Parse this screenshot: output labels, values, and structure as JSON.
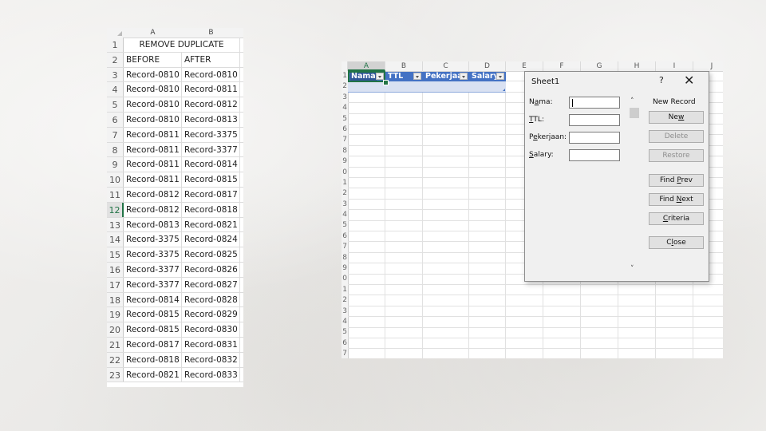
{
  "left_sheet": {
    "columns": [
      "A",
      "B"
    ],
    "title": "REMOVE DUPLICATE",
    "headers": [
      "BEFORE",
      "AFTER"
    ],
    "active_row": "12",
    "rows": [
      {
        "n": "1"
      },
      {
        "n": "2"
      },
      {
        "n": "3",
        "a": "Record-0810",
        "b": "Record-0810"
      },
      {
        "n": "4",
        "a": "Record-0810",
        "b": "Record-0811"
      },
      {
        "n": "5",
        "a": "Record-0810",
        "b": "Record-0812"
      },
      {
        "n": "6",
        "a": "Record-0810",
        "b": "Record-0813"
      },
      {
        "n": "7",
        "a": "Record-0811",
        "b": "Record-3375"
      },
      {
        "n": "8",
        "a": "Record-0811",
        "b": "Record-3377"
      },
      {
        "n": "9",
        "a": "Record-0811",
        "b": "Record-0814"
      },
      {
        "n": "10",
        "a": "Record-0811",
        "b": "Record-0815"
      },
      {
        "n": "11",
        "a": "Record-0812",
        "b": "Record-0817"
      },
      {
        "n": "12",
        "a": "Record-0812",
        "b": "Record-0818"
      },
      {
        "n": "13",
        "a": "Record-0813",
        "b": "Record-0821"
      },
      {
        "n": "14",
        "a": "Record-3375",
        "b": "Record-0824"
      },
      {
        "n": "15",
        "a": "Record-3375",
        "b": "Record-0825"
      },
      {
        "n": "16",
        "a": "Record-3377",
        "b": "Record-0826"
      },
      {
        "n": "17",
        "a": "Record-3377",
        "b": "Record-0827"
      },
      {
        "n": "18",
        "a": "Record-0814",
        "b": "Record-0828"
      },
      {
        "n": "19",
        "a": "Record-0815",
        "b": "Record-0829"
      },
      {
        "n": "20",
        "a": "Record-0815",
        "b": "Record-0830"
      },
      {
        "n": "21",
        "a": "Record-0817",
        "b": "Record-0831"
      },
      {
        "n": "22",
        "a": "Record-0818",
        "b": "Record-0832"
      },
      {
        "n": "23",
        "a": "Record-0821",
        "b": "Record-0833"
      }
    ]
  },
  "right_sheet": {
    "columns": [
      "A",
      "B",
      "C",
      "D",
      "E",
      "F",
      "G",
      "H",
      "I",
      "J"
    ],
    "selected_column": "A",
    "row_numbers": [
      "1",
      "2",
      "3",
      "4",
      "5",
      "6",
      "7",
      "8",
      "9",
      "0",
      "1",
      "2",
      "3",
      "4",
      "5",
      "6",
      "7",
      "8",
      "9",
      "0",
      "1",
      "2",
      "3",
      "4",
      "5",
      "6",
      "7"
    ],
    "table_headers": [
      "Nama",
      "TTL",
      "Pekerjaan",
      "Salary"
    ],
    "table_header_color": "#4472c4",
    "table_body_color": "#d9e1f2"
  },
  "dialog": {
    "title": "Sheet1",
    "help": "?",
    "close": "✕",
    "fields": [
      {
        "label_pre": "N",
        "label_u": "a",
        "label_post": "ma:",
        "value": ""
      },
      {
        "label_pre": "",
        "label_u": "T",
        "label_post": "TL:",
        "value": ""
      },
      {
        "label_pre": "P",
        "label_u": "e",
        "label_post": "kerjaan:",
        "value": ""
      },
      {
        "label_pre": "",
        "label_u": "S",
        "label_post": "alary:",
        "value": ""
      }
    ],
    "record_status": "New Record",
    "scroll_up": "˄",
    "scroll_down": "˅",
    "buttons": [
      {
        "pre": "Ne",
        "u": "w",
        "post": "",
        "disabled": false
      },
      {
        "pre": "",
        "u": "",
        "post": "Delete",
        "disabled": true
      },
      {
        "pre": "",
        "u": "",
        "post": "Restore",
        "disabled": true
      },
      {
        "pre": "Find ",
        "u": "P",
        "post": "rev",
        "disabled": false
      },
      {
        "pre": "Find ",
        "u": "N",
        "post": "ext",
        "disabled": false
      },
      {
        "pre": "",
        "u": "C",
        "post": "riteria",
        "disabled": false
      },
      {
        "pre": "C",
        "u": "l",
        "post": "ose",
        "disabled": false
      }
    ]
  }
}
